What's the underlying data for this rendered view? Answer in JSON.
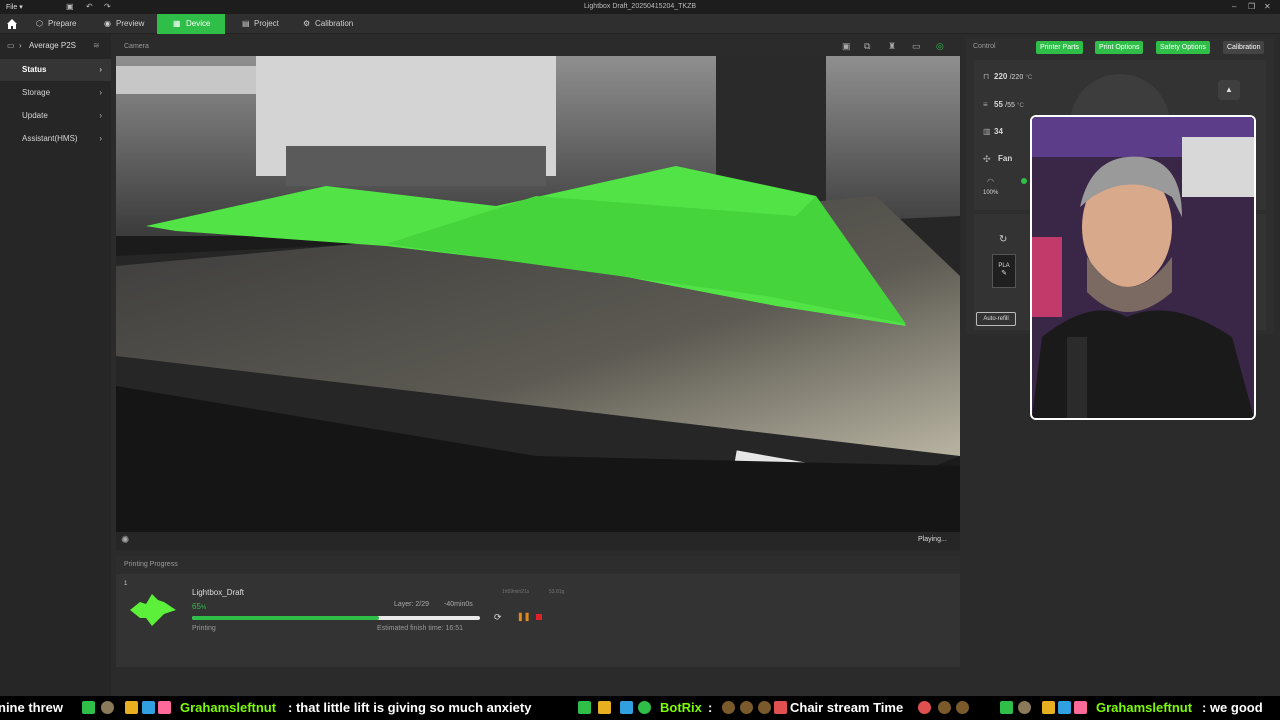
{
  "titlebar": {
    "file_label": "File",
    "window_title": "Lightbox Draft_20250415204_TKZB"
  },
  "nav": {
    "tabs": [
      {
        "label": "Prepare",
        "icon": "cube-icon"
      },
      {
        "label": "Preview",
        "icon": "eye-icon"
      },
      {
        "label": "Device",
        "icon": "device-icon",
        "active": true
      },
      {
        "label": "Project",
        "icon": "project-icon"
      },
      {
        "label": "Calibration",
        "icon": "calibration-icon"
      }
    ]
  },
  "sidebar": {
    "device_name": "Average P2S",
    "items": [
      {
        "label": "Status",
        "active": true
      },
      {
        "label": "Storage"
      },
      {
        "label": "Update"
      },
      {
        "label": "Assistant(HMS)"
      }
    ]
  },
  "camera": {
    "title": "Camera",
    "status": "Playing..."
  },
  "progress": {
    "title": "Printing Progress",
    "plate_number": "1",
    "job_name": "Lightbox_Draft",
    "percent_value": "65",
    "percent_unit": "%",
    "percent_fraction": 0.65,
    "state": "Printing",
    "layer": "Layer: 2/29",
    "remaining": "-40min0s",
    "estimated_finish": "Estimated finish time: 16:51",
    "print_time": "1h59min21s",
    "weight": "53.81g"
  },
  "control": {
    "title": "Control",
    "buttons": [
      "Printer Parts",
      "Print Options",
      "Safety Options",
      "Calibration"
    ],
    "nozzle_temp": "220",
    "nozzle_target": "/220",
    "bed_temp": "55",
    "bed_target": "/55",
    "chamber_temp": "34",
    "temp_unit": "°C",
    "fan_label": "Fan",
    "fan_speed": "100%",
    "filament": "PLA",
    "auto_refill": "Auto-refill"
  },
  "ticker": {
    "fragment_1": "nine threw",
    "user_1": "Grahamsleftnut",
    "message_1": ":  that little lift is giving so much anxiety",
    "user_2": "BotRix",
    "message_2": ":",
    "message_3": "Chair stream Time",
    "user_3": "Grahamsleftnut",
    "message_4": ":  we good"
  },
  "colors": {
    "accent": "#2fbf48",
    "pause": "#e08a1e",
    "stop": "#e0202a",
    "part": "#5cf03a"
  }
}
